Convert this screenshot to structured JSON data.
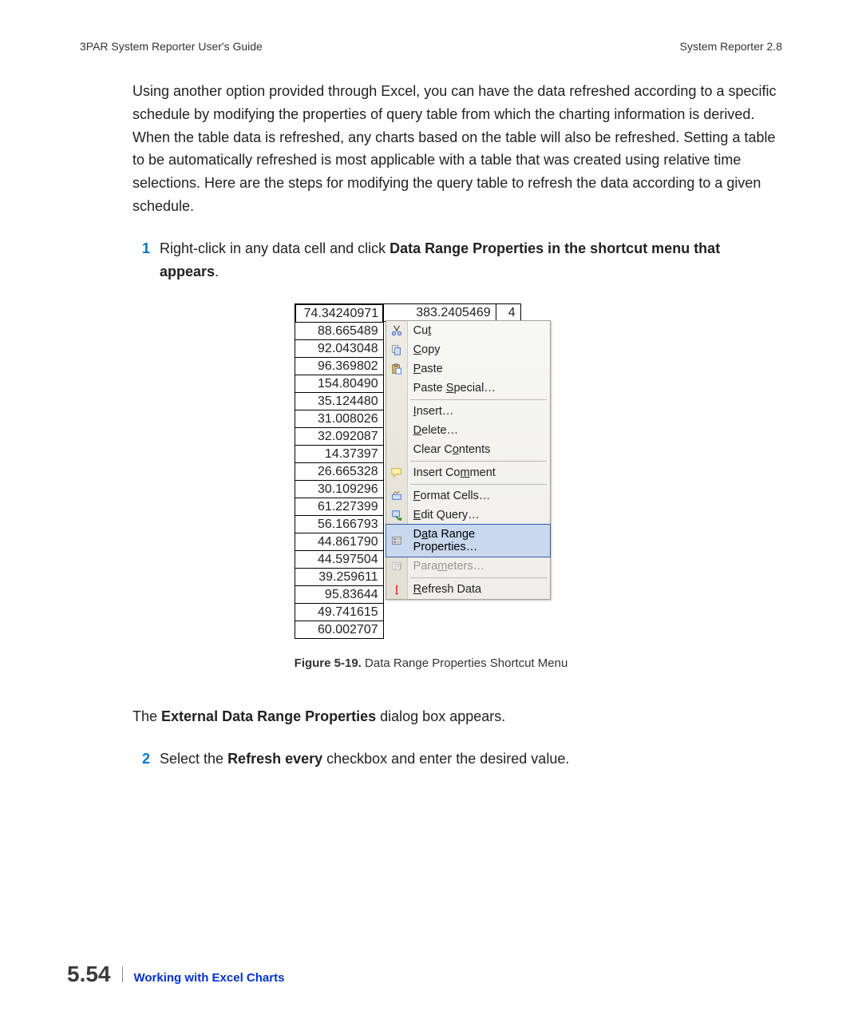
{
  "header": {
    "left": "3PAR System Reporter User's Guide",
    "right": "System Reporter 2.8"
  },
  "paragraph1": "Using another option provided through Excel, you can have the data refreshed according to a specific schedule by modifying the properties of query table from which the charting information is derived. When the table data is refreshed, any charts based on the table will also be refreshed. Setting a table to be automatically refreshed is most applicable with a table that was created using relative time selections. Here are the steps for modifying the query table to refresh the data according to a given schedule.",
  "step1": {
    "num": "1",
    "pre": "Right-click in any data cell and click ",
    "bold": "Data Range Properties in the shortcut menu that appears",
    "post": "."
  },
  "excel": {
    "colA_top": "74.34240971",
    "colA_rest": [
      "88.665489",
      "92.043048",
      "96.369802",
      "154.80490",
      "35.124480",
      "31.008026",
      "32.092087",
      "14.37397",
      "26.665328",
      "30.109296",
      "61.227399",
      "56.166793",
      "44.861790",
      "44.597504",
      "39.259611",
      "95.83644",
      "49.741615",
      "60.002707"
    ],
    "colB_top": "383.2405469",
    "colC_top": "4"
  },
  "menu": {
    "items": [
      {
        "label": "Cut",
        "u": 2,
        "icon": "cut"
      },
      {
        "label": "Copy",
        "u": 0,
        "icon": "copy"
      },
      {
        "label": "Paste",
        "u": 0,
        "icon": "paste"
      },
      {
        "label": "Paste Special…",
        "u": 6
      },
      {
        "sep": true
      },
      {
        "label": "Insert…",
        "u": 0
      },
      {
        "label": "Delete…",
        "u": 0
      },
      {
        "label": "Clear Contents",
        "u": 7
      },
      {
        "sep": true
      },
      {
        "label": "Insert Comment",
        "u": 9,
        "icon": "comment"
      },
      {
        "sep": true
      },
      {
        "label": "Format Cells…",
        "u": 0,
        "icon": "format"
      },
      {
        "label": "Edit Query…",
        "u": 0,
        "icon": "query"
      },
      {
        "label": "Data Range Properties…",
        "u": 1,
        "icon": "props",
        "sel": true
      },
      {
        "label": "Parameters…",
        "u": 4,
        "icon": "params",
        "disabled": true
      },
      {
        "sep": true
      },
      {
        "label": "Refresh Data",
        "u": 0,
        "icon": "refresh"
      }
    ]
  },
  "caption": {
    "bold": "Figure 5-19.",
    "rest": "  Data Range Properties Shortcut Menu"
  },
  "line_after": {
    "pre": "The ",
    "bold": "External Data Range Properties",
    "post": " dialog box appears."
  },
  "step2": {
    "num": "2",
    "pre": "Select the ",
    "bold": "Refresh every",
    "post": " checkbox and enter the desired value."
  },
  "footer": {
    "page": "5.54",
    "title": "Working with Excel Charts"
  }
}
